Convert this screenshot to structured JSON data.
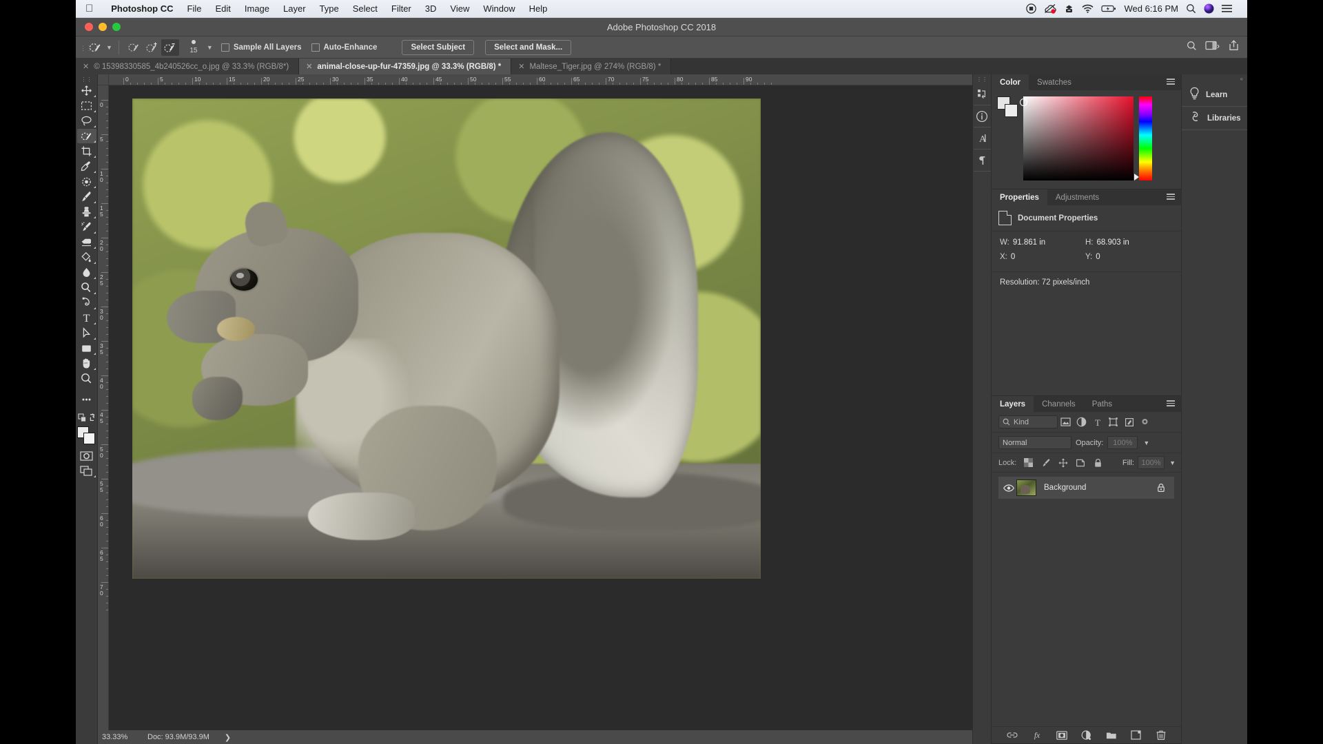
{
  "macbar": {
    "apple_icon": "apple-icon",
    "app_name": "Photoshop CC",
    "menus": [
      "File",
      "Edit",
      "Image",
      "Layer",
      "Type",
      "Select",
      "Filter",
      "3D",
      "View",
      "Window",
      "Help"
    ],
    "status_icons": [
      "screen-record-icon",
      "cloud-sync-icon",
      "dropbox-icon",
      "wifi-icon",
      "battery-charging-icon"
    ],
    "clock": "Wed 6:16 PM",
    "right_icons": [
      "search-icon",
      "siri-icon",
      "control-center-icon"
    ]
  },
  "window": {
    "title": "Adobe Photoshop CC 2018",
    "traffic_lights": [
      "close-button",
      "minimize-button",
      "maximize-button"
    ]
  },
  "options_bar": {
    "tool_icon": "quick-selection-tool-icon",
    "mode_icons": [
      "selection-new-icon",
      "selection-add-icon",
      "selection-subtract-icon"
    ],
    "brush_size": "15",
    "sample_all_layers_label": "Sample All Layers",
    "sample_all_layers_checked": false,
    "auto_enhance_label": "Auto-Enhance",
    "auto_enhance_checked": false,
    "select_subject_label": "Select Subject",
    "select_and_mask_label": "Select and Mask...",
    "right_icons": [
      "search-icon",
      "workspace-icon",
      "share-icon"
    ]
  },
  "tabs": [
    {
      "label": "© 15398330585_4b240526cc_o.jpg @ 33.3% (RGB/8*)",
      "active": false
    },
    {
      "label": "animal-close-up-fur-47359.jpg @ 33.3% (RGB/8) *",
      "active": true
    },
    {
      "label": "Maltese_Tiger.jpg @ 274% (RGB/8) *",
      "active": false
    }
  ],
  "toolbar": {
    "tools": [
      {
        "name": "move-tool",
        "icon": "move-icon",
        "active": false
      },
      {
        "name": "rectangular-marquee-tool",
        "icon": "marquee-icon",
        "active": false
      },
      {
        "name": "lasso-tool",
        "icon": "lasso-icon",
        "active": false
      },
      {
        "name": "quick-selection-tool",
        "icon": "quick-selection-icon",
        "active": true
      },
      {
        "name": "crop-tool",
        "icon": "crop-icon",
        "active": false
      },
      {
        "name": "eyedropper-tool",
        "icon": "eyedropper-icon",
        "active": false
      },
      {
        "name": "spot-healing-brush-tool",
        "icon": "healing-icon",
        "active": false
      },
      {
        "name": "brush-tool",
        "icon": "brush-icon",
        "active": false
      },
      {
        "name": "clone-stamp-tool",
        "icon": "stamp-icon",
        "active": false
      },
      {
        "name": "history-brush-tool",
        "icon": "history-brush-icon",
        "active": false
      },
      {
        "name": "eraser-tool",
        "icon": "eraser-icon",
        "active": false
      },
      {
        "name": "gradient-tool",
        "icon": "gradient-icon",
        "active": false
      },
      {
        "name": "blur-tool",
        "icon": "blur-drop-icon",
        "active": false
      },
      {
        "name": "dodge-tool",
        "icon": "dodge-icon",
        "active": false
      },
      {
        "name": "pen-tool",
        "icon": "pen-icon",
        "active": false
      },
      {
        "name": "type-tool",
        "icon": "type-t-icon",
        "active": false
      },
      {
        "name": "path-selection-tool",
        "icon": "arrow-cursor-icon",
        "active": false
      },
      {
        "name": "rectangle-tool",
        "icon": "rectangle-icon",
        "active": false
      },
      {
        "name": "hand-tool",
        "icon": "hand-icon",
        "active": false
      },
      {
        "name": "zoom-tool",
        "icon": "magnifier-icon",
        "active": false
      },
      {
        "name": "edit-toolbar",
        "icon": "ellipsis-icon",
        "active": false
      }
    ],
    "swap_colors_icon": "swap-colors-icon",
    "default_colors_icon": "default-colors-icon",
    "quick_mask_icon": "quick-mask-icon",
    "screen_mode_icon": "screen-mode-icon",
    "foreground_color": "#ececec",
    "background_color": "#f4f4f4"
  },
  "rulers": {
    "h_labels": [
      "0",
      "5",
      "10",
      "15",
      "20",
      "25",
      "30",
      "35",
      "40",
      "45",
      "50",
      "55",
      "60",
      "65",
      "70",
      "75",
      "80",
      "85",
      "90"
    ],
    "v_labels": [
      "0",
      "5",
      "10",
      "15",
      "20",
      "25",
      "30",
      "35",
      "40",
      "45",
      "50",
      "55",
      "60",
      "65",
      "70"
    ],
    "unit": "in"
  },
  "status_bar": {
    "zoom": "33.33%",
    "doc": "Doc: 93.9M/93.9M",
    "expand_icon": "chevron-right-icon"
  },
  "dock_strip": {
    "icons": [
      "history-panel-icon",
      "info-panel-icon",
      "character-panel-icon",
      "paragraph-panel-icon"
    ]
  },
  "color_panel": {
    "tabs": [
      {
        "label": "Color",
        "active": true
      },
      {
        "label": "Swatches",
        "active": false
      }
    ],
    "menu_icon": "panel-menu-icon",
    "foreground_swatch": "#ececec",
    "background_swatch": "#f4f4f4",
    "field_hue_color": "#e8112d"
  },
  "properties_panel": {
    "tabs": [
      {
        "label": "Properties",
        "active": true
      },
      {
        "label": "Adjustments",
        "active": false
      }
    ],
    "menu_icon": "panel-menu-icon",
    "header_icon": "document-properties-icon",
    "header_label": "Document Properties",
    "fields": [
      {
        "key": "W:",
        "value": "91.861 in"
      },
      {
        "key": "H:",
        "value": "68.903 in"
      },
      {
        "key": "X:",
        "value": "0"
      },
      {
        "key": "Y:",
        "value": "0"
      }
    ],
    "resolution": "Resolution: 72 pixels/inch"
  },
  "layers_panel": {
    "tabs": [
      {
        "label": "Layers",
        "active": true
      },
      {
        "label": "Channels",
        "active": false
      },
      {
        "label": "Paths",
        "active": false
      }
    ],
    "menu_icon": "panel-menu-icon",
    "filter_label": "Kind",
    "filter_icons": [
      "filter-pixel-icon",
      "filter-adjustment-icon",
      "filter-type-icon",
      "filter-shape-icon",
      "filter-smart-object-icon",
      "filter-toggle-icon"
    ],
    "blend_mode": "Normal",
    "opacity_label": "Opacity:",
    "opacity_value": "100%",
    "lock_label": "Lock:",
    "lock_icons": [
      "lock-transparency-icon",
      "lock-image-icon",
      "lock-position-icon",
      "lock-artboard-icon",
      "lock-all-icon"
    ],
    "fill_label": "Fill:",
    "fill_value": "100%",
    "layers": [
      {
        "name": "Background",
        "visible": true,
        "locked": true,
        "visibility_icon": "eye-icon",
        "lock_icon": "lock-icon"
      }
    ],
    "footer_icons": [
      "link-layers-icon",
      "add-fx-icon",
      "add-mask-icon",
      "new-adjustment-icon",
      "new-group-icon",
      "new-layer-icon",
      "delete-layer-icon"
    ]
  },
  "far_right_dock": {
    "items": [
      {
        "label": "Learn",
        "icon": "lightbulb-icon"
      },
      {
        "label": "Libraries",
        "icon": "creative-cloud-icon"
      }
    ]
  }
}
